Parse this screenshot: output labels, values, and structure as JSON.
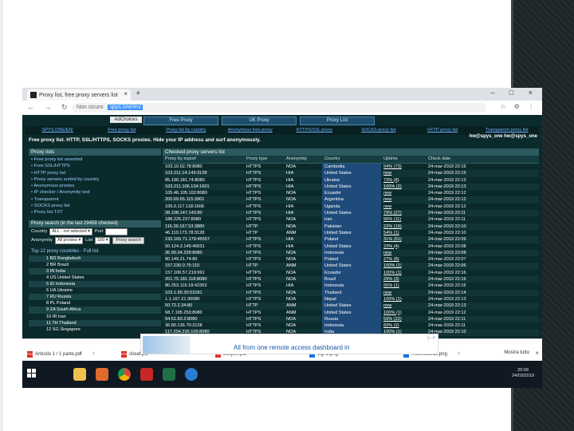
{
  "browser": {
    "tab_title": "Proxy list, free proxy servers list",
    "close_glyph": "×",
    "new_tab_glyph": "+",
    "window_controls": "– □ ×",
    "nav_glyphs": "← → ↻",
    "security_label": "Non sicuro",
    "url": "spys.one/en/",
    "tool_glyphs": "☆ ⚙ ⋮"
  },
  "page": {
    "ad_button": "AdChoices",
    "top_tabs": [
      "Free Proxy",
      "UK Proxy",
      "Proxy List"
    ],
    "menu": [
      "SPYS.ONE/EN/",
      "Free proxy list",
      "Proxy list by country",
      "Anonymous free proxy",
      "HTTPS/SSL proxy",
      "SOCKS proxy list",
      "HTTP proxy list",
      "Transparent proxy list"
    ],
    "tagline": "Free proxy list. HTTP, SSL/HTTPS, SOCKS proxies. Hide your IP address and surf anonymously.",
    "email": "hw@spys_one hw@spys_one",
    "proxy_lists": {
      "heading": "Proxy lists",
      "items": [
        "• Free proxy list unsorted",
        "• Free SSL/HTTPS",
        "• HTTP proxy list",
        "• Proxy servers sorted by country",
        "• Anonymous proxies",
        "• IP checker / Anonymity test",
        "• Transparent",
        "• SOCKS proxy list",
        "• Proxy list TXT"
      ]
    },
    "search": {
      "heading": "Proxy search (in the last 29458 checked)",
      "country_label": "Country",
      "country_value": "ALL - not selected",
      "port_label": "Port",
      "anonymity_label": "Anonymity",
      "anonymity_value": "All proxies",
      "list_label": "List",
      "list_value": "100",
      "search_button": "Proxy search",
      "dropdown_glyph": "▾"
    },
    "countries": {
      "heading": "Top 12 proxy countries - Full list",
      "items": [
        "1 BD Bangladesh",
        "2 BR Brazil",
        "3 IN India",
        "4 US United States",
        "5 ID Indonesia",
        "6 UA Ukraine",
        "7 RU Russia",
        "8 PL Poland",
        "9 ZA South Africa",
        "10 IR Iran",
        "11 TH Thailand",
        "12 SG Singapore"
      ]
    },
    "table": {
      "heading": "Checked proxy servers list",
      "columns": [
        "Proxy by export",
        "Proxy type",
        "Anonymity",
        "Country",
        "Uptime",
        "Check date"
      ],
      "rows": [
        [
          "103.10.52.78:8080",
          "HTTPS",
          "NOA",
          "Cambodia",
          "54% (73)",
          "24-mar-2019 22:15"
        ],
        [
          "103.211.14.143:3128",
          "HTTPS",
          "HIA",
          "United States",
          "new",
          "24-mar-2019 22:15"
        ],
        [
          "85.190.181.74:8080",
          "HTTPS",
          "HIA",
          "Ukraine",
          "73% (8)",
          "24-mar-2019 22:13"
        ],
        [
          "103.211.106.134:1601",
          "HTTPS",
          "HIA",
          "United States",
          "100% (2)",
          "24-mar-2019 22:13"
        ],
        [
          "105.46.105.102:8080",
          "HTTPS",
          "NOA",
          "Ecuador",
          "new",
          "24-mar-2019 22:12"
        ],
        [
          "200.69.65.115:3901",
          "HTTPS",
          "NOA",
          "Argentina",
          "new",
          "24-mar-2019 22:12"
        ],
        [
          "105.0.117.118:1606",
          "HTTPS",
          "HIA",
          "Uganda",
          "new",
          "24-mar-2019 22:12"
        ],
        [
          "38.108.147.143:80",
          "HTTPS",
          "HIA",
          "United States",
          "79% (27)",
          "24-mar-2019 22:11"
        ],
        [
          "188.225.237:8080",
          "HTTPS",
          "NOA",
          "Iran",
          "56% (11)",
          "24-mar-2019 22:11"
        ],
        [
          "116.39.167.53:3880",
          "HTTP",
          "NOA",
          "Pakistan",
          "22% (19)",
          "24-mar-2019 22:10"
        ],
        [
          "46.110.173.78:3128",
          "HTTP",
          "ANM",
          "United States",
          "54% (1)",
          "24-mar-2019 22:10"
        ],
        [
          "193.165.71.179:45557",
          "HTTPS",
          "HIA",
          "Poland",
          "31% (61)",
          "24-mar-2019 22:09"
        ],
        [
          "50.124.3.149:40031",
          "HTTPS",
          "HIA",
          "United States",
          "23% (4)",
          "24-mar-2019 22:08"
        ],
        [
          "36.90.34.229:8080",
          "HTTPS",
          "NOA",
          "Indonesia",
          "new",
          "24-mar-2019 22:08"
        ],
        [
          "80.149.21.74:80",
          "HTTPS",
          "NOA",
          "Poland",
          "27% (8)",
          "24-mar-2019 22:07"
        ],
        [
          "157.230.0.75:110",
          "HTTP",
          "ANM",
          "United States",
          "100% (1)",
          "24-mar-2019 22:06"
        ],
        [
          "157.100.57.219:991",
          "HTTPS",
          "NOA",
          "Ecuador",
          "100% (1)",
          "24-mar-2019 22:16"
        ],
        [
          "201.75.181.118:8080",
          "HTTPS",
          "NOA",
          "Brazil",
          "29% (3)",
          "24-mar-2019 22:16"
        ],
        [
          "80.253.116.18:42353",
          "HTTPS",
          "HIA",
          "Indonesia",
          "55% (1)",
          "24-mar-2019 22:15"
        ],
        [
          "103.1.95.30:53181",
          "HTTPS",
          "NOA",
          "Thailand",
          "new",
          "24-mar-2019 22:14"
        ],
        [
          "1.1.167.21:36080",
          "HTTPS",
          "NOA",
          "Nepal",
          "100% (1)",
          "24-mar-2019 22:13"
        ],
        [
          "50.72.2.34:80",
          "HTTP",
          "ANM",
          "United States",
          "new",
          "24-mar-2019 22:13"
        ],
        [
          "68.7.195.253:8080",
          "HTTPS",
          "ANM",
          "United States",
          "100% (1)",
          "24-mar-2019 22:12"
        ],
        [
          "94.51.83.2:8080",
          "HTTPS",
          "NOA",
          "Russia",
          "59% (22)",
          "24-mar-2019 22:11"
        ],
        [
          "36.80.136.70:3128",
          "HTTPS",
          "NOA",
          "Indonesia",
          "83% (2)",
          "24-mar-2019 22:11"
        ],
        [
          "117.204.236.105:8080",
          "HTTPS",
          "NOA",
          "India",
          "100% (1)",
          "24-mar-2019 22:10"
        ]
      ]
    }
  },
  "ad_banner": {
    "text": "All from one remote access dashboard in",
    "close": "▷ ×"
  },
  "downloads": {
    "items": [
      {
        "name": "Articolo 1 / 1 parte.pdf",
        "type": "pdf"
      },
      {
        "name": "cloud.pdf",
        "type": "pdf"
      },
      {
        "name": "Eclipse.pdf",
        "type": "pdf"
      },
      {
        "name": "wg41.png",
        "type": "img"
      },
      {
        "name": "Vittoria/2811.png",
        "type": "img"
      }
    ],
    "pdf_label": "PDF",
    "chevron": "˄",
    "show_all": "Mostra tutto",
    "close": "×"
  },
  "taskbar": {
    "time": "20:09",
    "date": "24/03/2019"
  }
}
